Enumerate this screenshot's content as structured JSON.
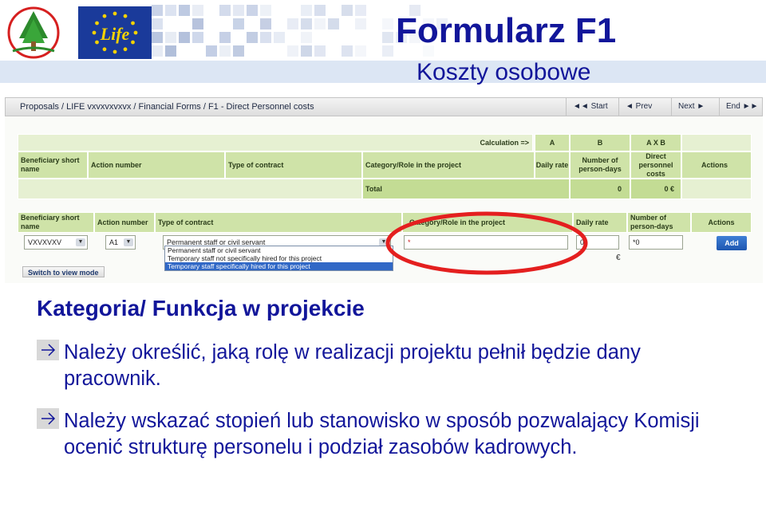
{
  "slide": {
    "title": "Formularz F1",
    "subtitle": "Koszty osobowe",
    "logos": [
      "tree-logo",
      "life-logo"
    ],
    "life_logo_text": "Life"
  },
  "screenshot": {
    "breadcrumb": "Proposals / LIFE vxvxvxvxvx / Financial Forms / F1 - Direct Personnel costs",
    "nav": {
      "start": "◄◄ Start",
      "prev": "◄ Prev",
      "next": "Next ►",
      "end": "End ►►"
    },
    "summary_table": {
      "calc_label": "Calculation =>",
      "col_letters": [
        "A",
        "B",
        "A X B"
      ],
      "headers": [
        "Beneficiary short name",
        "Action number",
        "Type of contract",
        "Category/Role in the project",
        "Daily rate",
        "Number of person-days",
        "Direct personnel costs",
        "Actions"
      ],
      "total_label": "Total",
      "total_person_days": "0",
      "total_costs": "0 €"
    },
    "entry_table": {
      "headers": [
        "Beneficiary short name",
        "Action number",
        "Type of contract",
        "Category/Role in the project",
        "Daily rate",
        "Number of person-days",
        "Actions"
      ],
      "beneficiary_value": "VXVXVXV",
      "action_value": "A1",
      "contract_value": "Permanent staff or civil servant",
      "contract_options": [
        "Permanent staff or civil servant",
        "Temporary staff not specifically hired for this project",
        "Temporary staff specifically hired for this project"
      ],
      "contract_highlighted_index": 2,
      "category_value": "*",
      "daily_rate_value": "0",
      "person_days_value": "*0",
      "currency": "€",
      "add_label": "Add",
      "switch_label": "Switch to view mode"
    },
    "highlight_color": "#e41f1f"
  },
  "body": {
    "heading": "Kategoria/ Funkcja w projekcie",
    "bullets": [
      "Należy określić, jaką rolę w realizacji projektu pełnił będzie dany pracownik.",
      "Należy wskazać stopień lub stanowisko w sposób pozwalający Komisji ocenić strukturę personelu i podział zasobów kadrowych."
    ]
  },
  "colors": {
    "title_blue": "#12169a",
    "table_green": "#cfe3a8",
    "bullet_gray": "#d8d8d8"
  }
}
